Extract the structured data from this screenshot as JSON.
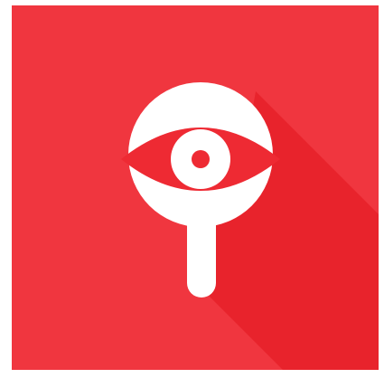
{
  "app_icon": {
    "icon": "eye-magnifier-icon",
    "colors": {
      "background": "#f0363f",
      "long_shadow": "#e8232c",
      "glyph": "#ffffff",
      "eye": "#ee2a33"
    }
  }
}
